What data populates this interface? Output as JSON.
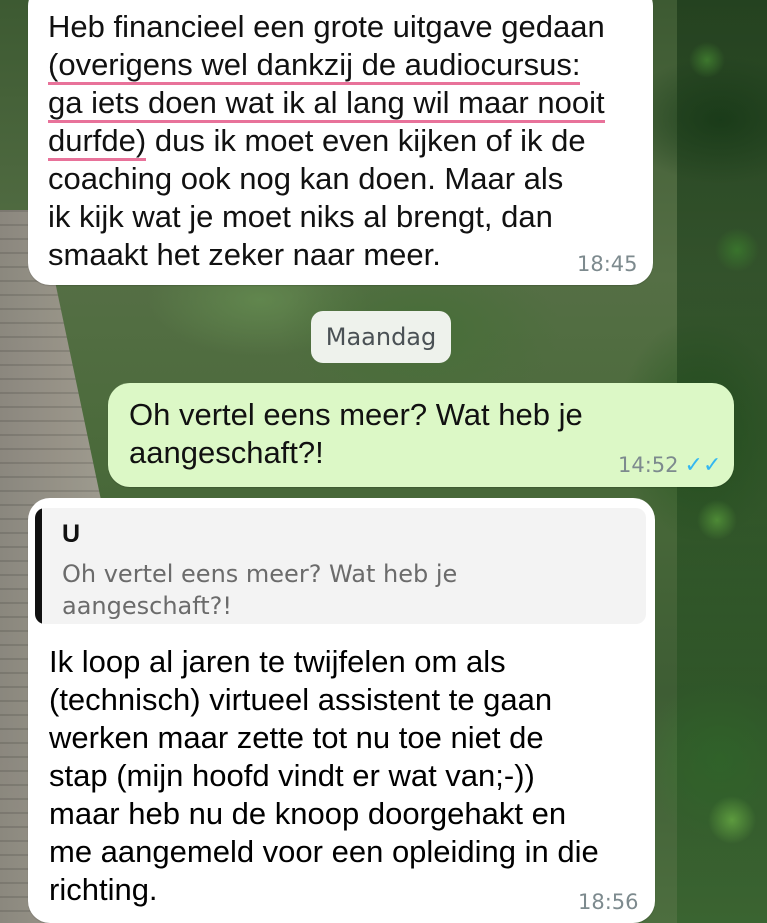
{
  "messages": [
    {
      "direction": "incoming",
      "plain_before": "Heb financieel een grote uitgave gedaan",
      "highlighted": [
        "(overigens wel dankzij de audiocursus:",
        "ga iets doen wat ik al lang wil maar nooit",
        "durfde)"
      ],
      "after_highlight": " dus ik moet even kijken of ik de",
      "rest": "coaching ook nog kan doen. Maar als\nik kijk wat je moet niks al brengt, dan\nsmaakt het zeker naar meer.",
      "time": "18:45",
      "highlight_color": "#e8729a"
    },
    {
      "direction": "outgoing",
      "text": "Oh vertel eens meer? Wat heb je\naangeschaft?!",
      "time": "14:52",
      "status": "double-check-read-icon"
    },
    {
      "direction": "incoming",
      "quote": {
        "author": "U",
        "text": "Oh vertel eens meer? Wat heb je\naangeschaft?!"
      },
      "text": "Ik loop al jaren te twijfelen om als\n(technisch) virtueel assistent te gaan\nwerken maar zette tot nu toe niet de\nstap (mijn hoofd vindt er wat van;-))\nmaar heb nu de knoop doorgehakt en\nme aangemeld voor een opleiding in die\nrichting.",
      "time": "18:56"
    }
  ],
  "date_divider": "Maandag",
  "colors": {
    "incoming_bubble": "#ffffff",
    "outgoing_bubble": "#dcf8c6",
    "read_ticks": "#34b7f1"
  }
}
